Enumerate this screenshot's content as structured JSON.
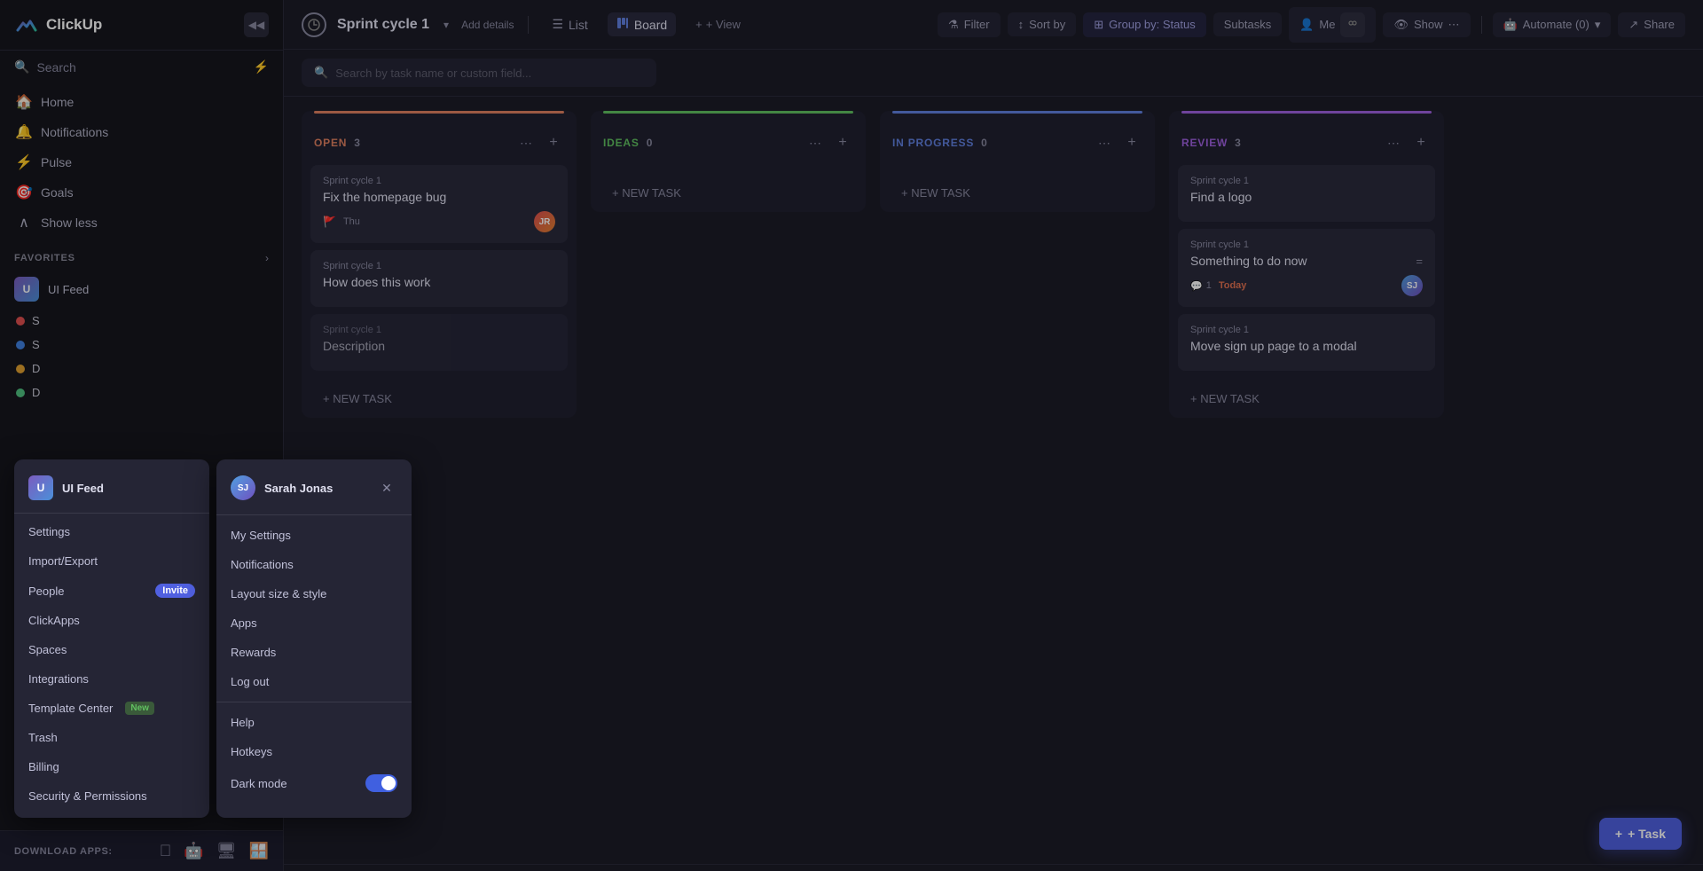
{
  "app": {
    "logo_text": "ClickUp",
    "collapse_tooltip": "Collapse sidebar"
  },
  "sidebar": {
    "search_placeholder": "Search",
    "nav_items": [
      {
        "id": "home",
        "label": "Home",
        "icon": "🏠"
      },
      {
        "id": "notifications",
        "label": "Notifications",
        "icon": "🔔"
      },
      {
        "id": "pulse",
        "label": "Pulse",
        "icon": "⚡"
      },
      {
        "id": "goals",
        "label": "Goals",
        "icon": "🎯"
      }
    ],
    "show_less": "Show less",
    "favorites_label": "FAVORITES",
    "workspace_item": {
      "label": "UI Feed",
      "initials": "U"
    },
    "colored_items": [
      {
        "label": "S",
        "color": "#e05050"
      },
      {
        "label": "S",
        "color": "#4080e0"
      },
      {
        "label": "D",
        "color": "#e0a030"
      },
      {
        "label": "D",
        "color": "#50c080"
      }
    ],
    "download_label": "DOWNLOAD APPS:"
  },
  "topbar": {
    "sprint_name": "Sprint cycle 1",
    "add_details": "Add details",
    "list_label": "List",
    "board_label": "Board",
    "view_label": "+ View",
    "filter_label": "Filter",
    "sort_by_label": "Sort by",
    "group_by_label": "Group by: Status",
    "subtasks_label": "Subtasks",
    "me_label": "Me",
    "show_label": "Show",
    "automate_label": "Automate (0)",
    "share_label": "Share"
  },
  "board_search": {
    "placeholder": "Search by task name or custom field..."
  },
  "columns": [
    {
      "id": "open",
      "title": "OPEN",
      "count": "3",
      "color": "#e08060",
      "cards": [
        {
          "sprint": "Sprint cycle 1",
          "title": "Fix the homepage bug",
          "flag": "Thu",
          "avatar": "JR",
          "avatar_color": "linear-gradient(135deg, #e05050, #e08030)"
        },
        {
          "sprint": "Sprint cycle 1",
          "title": "How does this work",
          "flag": null,
          "avatar": null,
          "avatar_color": null
        },
        {
          "sprint": "Sprint cycle 1",
          "title": "Description",
          "flag": null,
          "avatar": null,
          "avatar_color": null,
          "is_partial": true
        }
      ],
      "new_task_label": "+ NEW TASK"
    },
    {
      "id": "ideas",
      "title": "IDEAS",
      "count": "0",
      "color": "#60c060",
      "cards": [],
      "new_task_label": "+ NEW TASK"
    },
    {
      "id": "inprogress",
      "title": "IN PROGRESS",
      "count": "0",
      "color": "#6080e0",
      "cards": [],
      "new_task_label": "+ NEW TASK"
    },
    {
      "id": "review",
      "title": "REVIEW",
      "count": "3",
      "color": "#a060e0",
      "cards": [
        {
          "sprint": "Sprint cycle 1",
          "title": "Find a logo",
          "flag": null,
          "avatar": null,
          "avatar_color": null
        },
        {
          "sprint": "Sprint cycle 1",
          "title": "Something to do now",
          "flag": null,
          "comment_count": "1",
          "due": "Today",
          "avatar": "SJ",
          "avatar_color": "linear-gradient(135deg, #50a0e0, #7050c0)"
        },
        {
          "sprint": "Sprint cycle 1",
          "title": "Move sign up page to a modal",
          "flag": null,
          "avatar": null,
          "avatar_color": null
        }
      ],
      "new_task_label": "+ NEW TASK"
    }
  ],
  "workspace_menu": {
    "avatar": "U",
    "name": "UI Feed",
    "items": [
      {
        "id": "settings",
        "label": "Settings"
      },
      {
        "id": "import-export",
        "label": "Import/Export"
      },
      {
        "id": "people",
        "label": "People",
        "badge": "Invite"
      },
      {
        "id": "clickapps",
        "label": "ClickApps"
      },
      {
        "id": "spaces",
        "label": "Spaces"
      },
      {
        "id": "integrations",
        "label": "Integrations"
      },
      {
        "id": "template-center",
        "label": "Template Center",
        "new_badge": "New"
      },
      {
        "id": "trash",
        "label": "Trash"
      },
      {
        "id": "billing",
        "label": "Billing"
      },
      {
        "id": "security",
        "label": "Security & Permissions"
      }
    ]
  },
  "user_submenu": {
    "name": "Sarah Jonas",
    "initials": "SJ",
    "items": [
      {
        "id": "my-settings",
        "label": "My Settings"
      },
      {
        "id": "notifications",
        "label": "Notifications"
      },
      {
        "id": "layout-size",
        "label": "Layout size & style"
      },
      {
        "id": "apps",
        "label": "Apps"
      },
      {
        "id": "rewards",
        "label": "Rewards"
      },
      {
        "id": "log-out",
        "label": "Log out"
      }
    ],
    "help_label": "Help",
    "hotkeys_label": "Hotkeys",
    "dark_mode_label": "Dark mode",
    "dark_mode_on": true
  },
  "fab": {
    "label": "+ Task"
  }
}
